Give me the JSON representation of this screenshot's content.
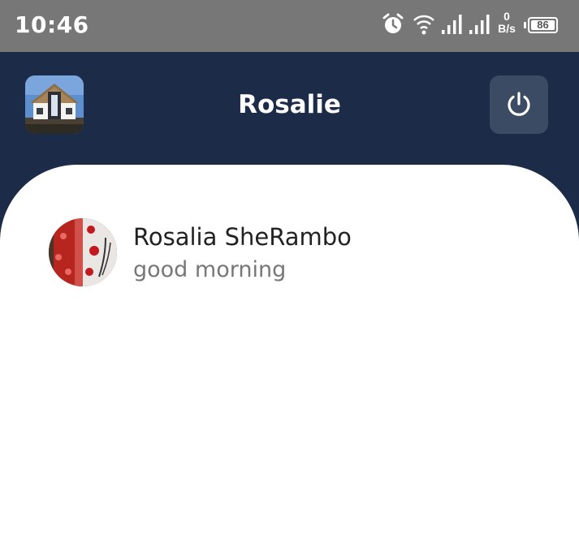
{
  "status_bar": {
    "time": "10:46",
    "net_speed_value": "0",
    "net_speed_unit": "B/s",
    "battery": "86",
    "icons": [
      "alarm-icon",
      "wifi-icon",
      "signal-icon",
      "signal-icon",
      "battery-icon"
    ]
  },
  "header": {
    "title": "Rosalie",
    "avatar_icon": "house-photo",
    "action_icon": "power-icon"
  },
  "chats": [
    {
      "name": "Rosalia SheRambo",
      "last_message": "good morning",
      "avatar_icon": "birthday-cake-photo"
    }
  ],
  "colors": {
    "header_bg": "#1c2b47",
    "status_bar_bg": "#777777",
    "power_button_bg": "#3b4b64",
    "content_bg": "#ffffff",
    "name_text": "#222222",
    "message_text": "#777777"
  }
}
